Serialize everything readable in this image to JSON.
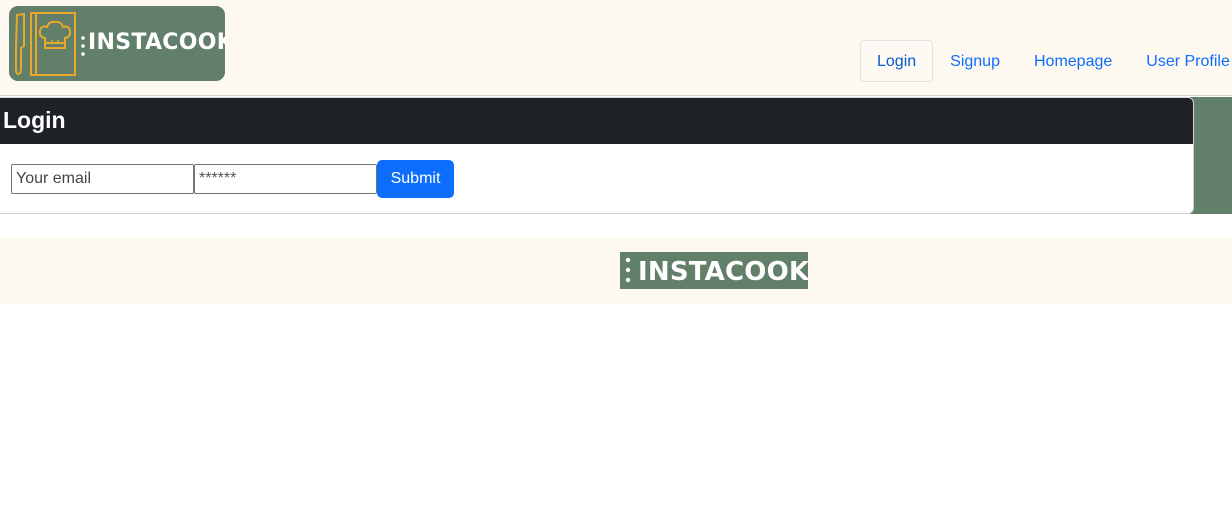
{
  "brand": {
    "name": "INSTACOOK",
    "accent": "#627f6a",
    "icon_color": "#e8a92b"
  },
  "nav": {
    "items": [
      {
        "label": "Login",
        "active": true
      },
      {
        "label": "Signup",
        "active": false
      },
      {
        "label": "Homepage",
        "active": false
      },
      {
        "label": "User Profile",
        "active": false
      }
    ]
  },
  "login": {
    "title": "Login",
    "email_placeholder": "Your email",
    "password_placeholder": "******",
    "submit_label": "Submit"
  },
  "footer": {
    "brand": "INSTACOOK"
  },
  "colors": {
    "header_bg": "#fdf8f0",
    "card_header_bg": "#1e2226",
    "link": "#0d6efd",
    "button": "#0d6efd"
  }
}
